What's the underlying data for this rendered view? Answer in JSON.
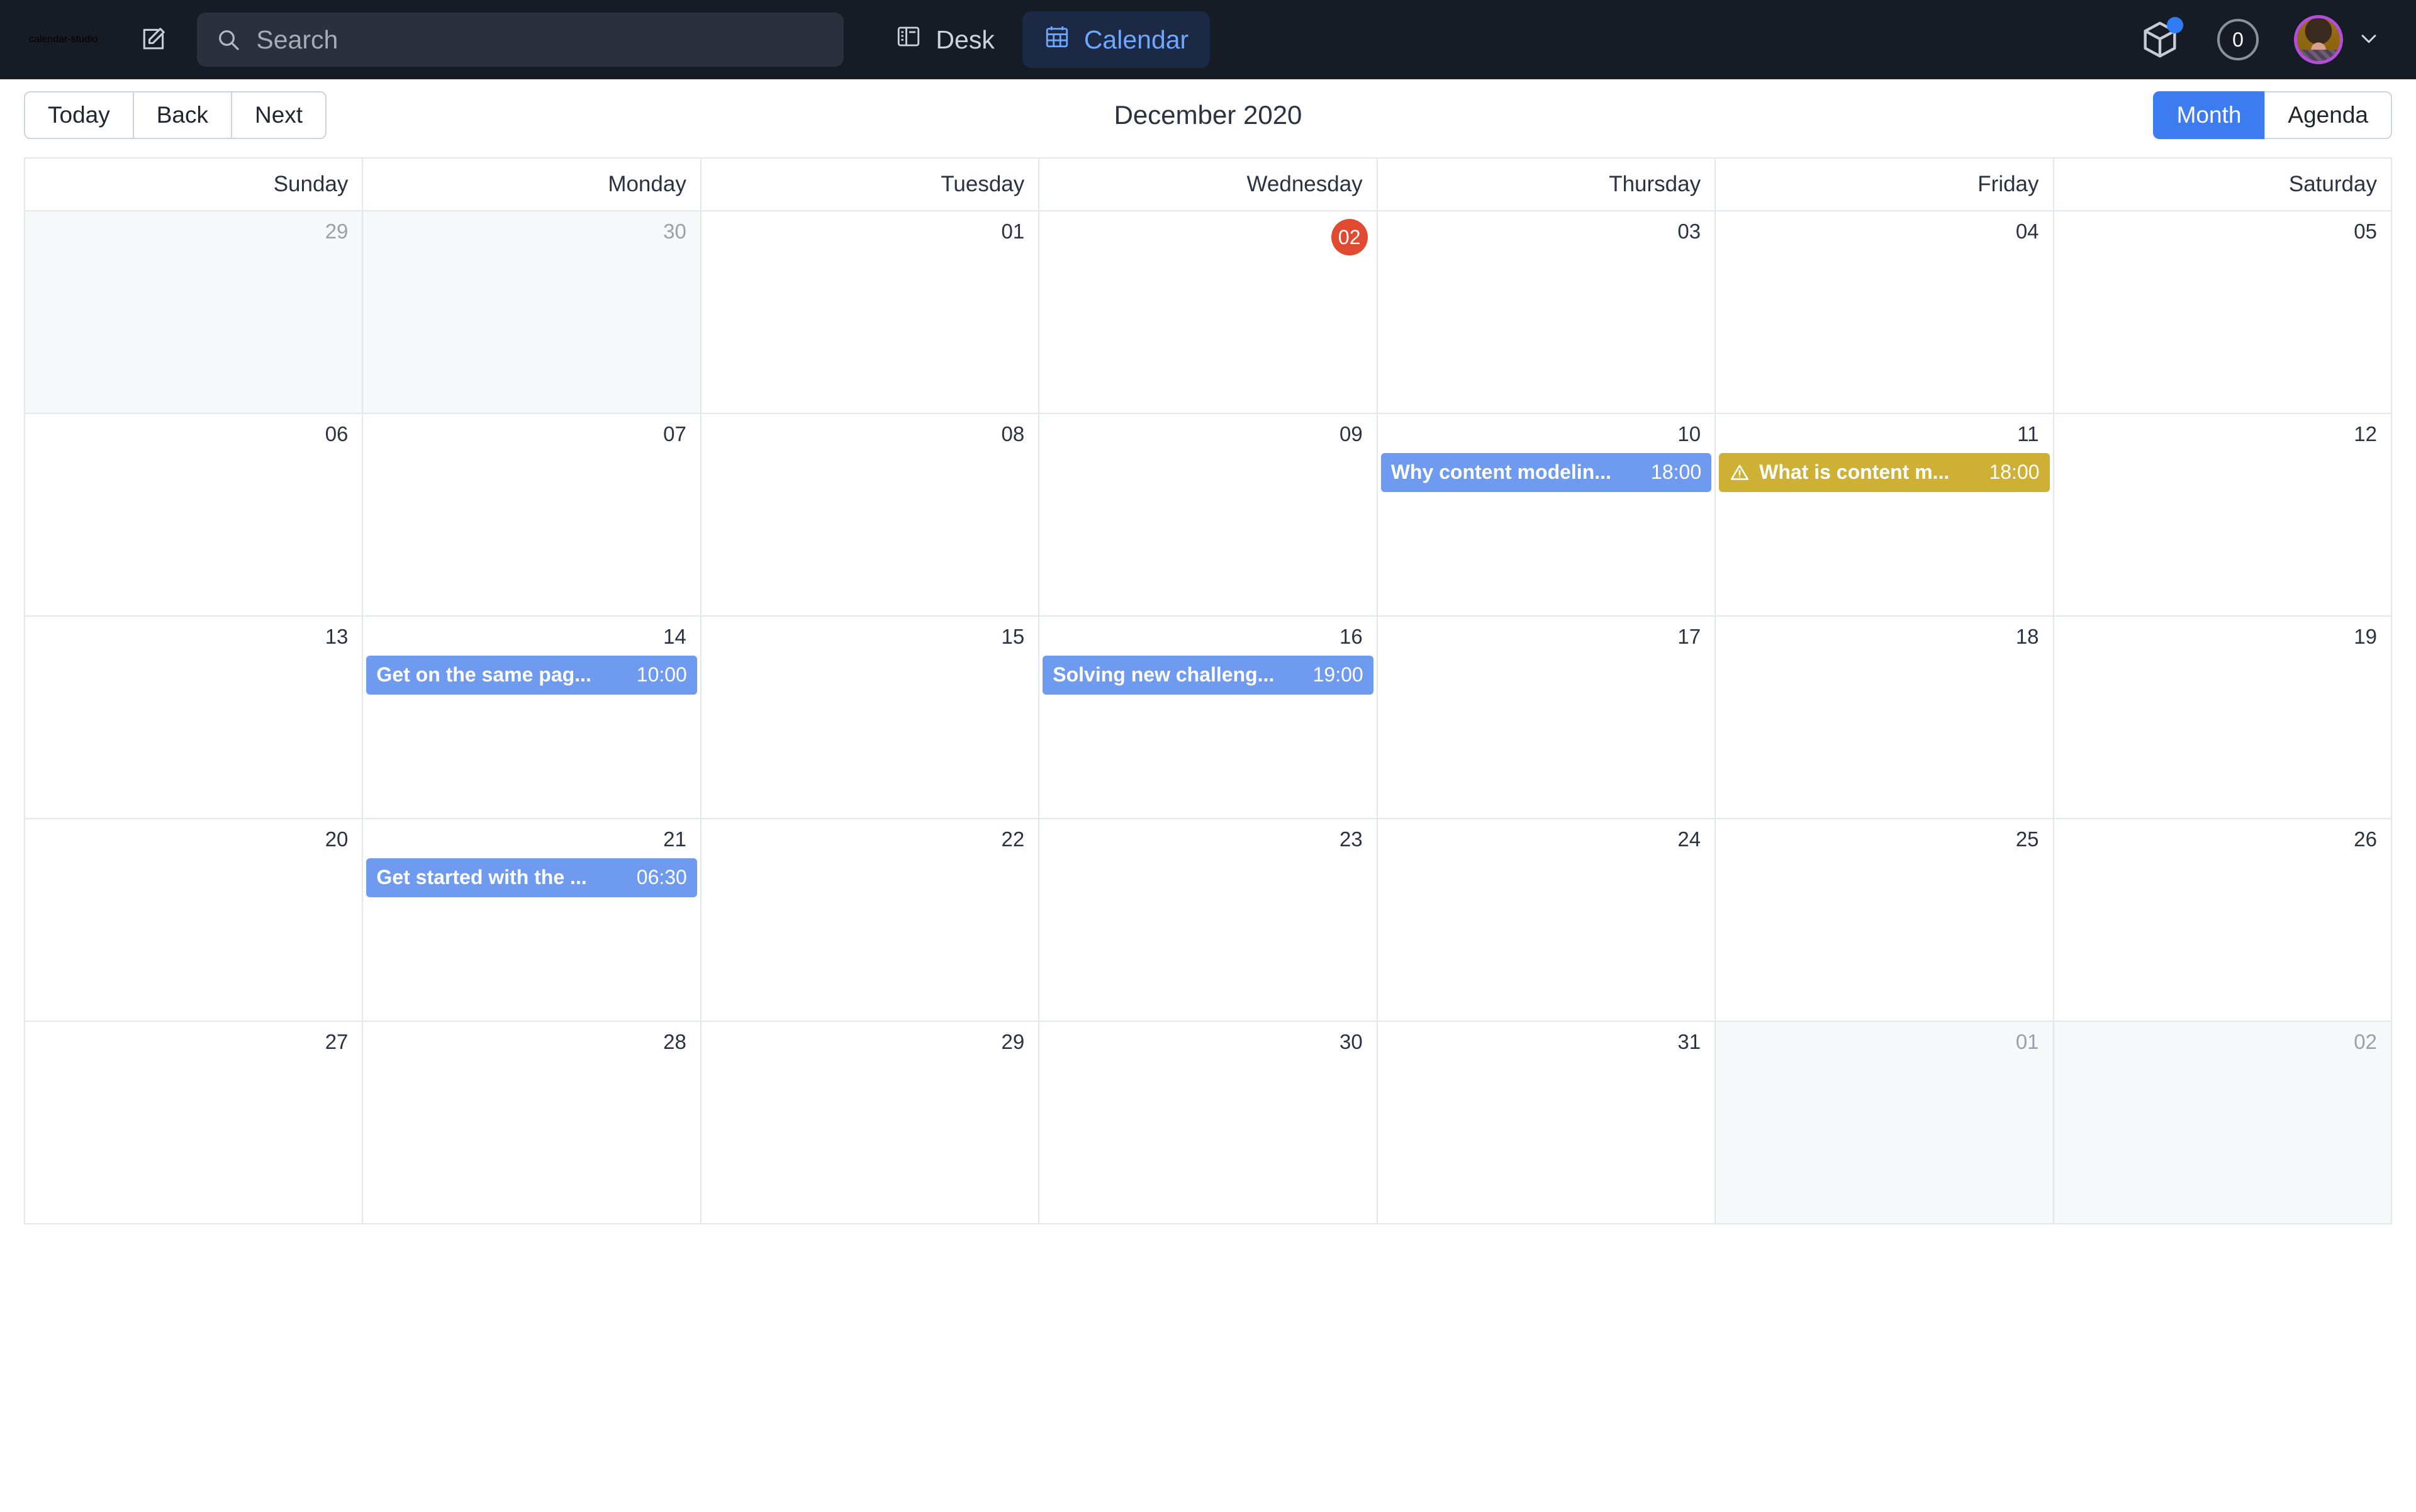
{
  "navbar": {
    "brand": "calendar-studio",
    "compose_icon": "compose-edit-icon",
    "search": {
      "value": "",
      "placeholder": "Search",
      "icon": "search-icon"
    },
    "tabs": [
      {
        "label": "Desk",
        "icon": "desk-layout-icon",
        "active": false
      },
      {
        "label": "Calendar",
        "icon": "calendar-grid-icon",
        "active": true
      }
    ],
    "package_icon": "package-box-icon",
    "package_has_badge": true,
    "notification_count": "0",
    "avatar_icon": "user-avatar",
    "avatar_ring_color": "#b44ddb",
    "chevron_icon": "chevron-down-icon"
  },
  "toolbar": {
    "nav_buttons": [
      {
        "label": "Today"
      },
      {
        "label": "Back"
      },
      {
        "label": "Next"
      }
    ],
    "title": "December 2020",
    "views": [
      {
        "label": "Month",
        "active": true
      },
      {
        "label": "Agenda",
        "active": false
      }
    ],
    "active_color": "#3c7cf0"
  },
  "calendar": {
    "day_headers": [
      "Sunday",
      "Monday",
      "Tuesday",
      "Wednesday",
      "Thursday",
      "Friday",
      "Saturday"
    ],
    "today_color": "#df4a31",
    "event_colors": {
      "blue": "#6e9bf0",
      "yellow": "#cdb034"
    },
    "weeks": [
      [
        {
          "num": "29",
          "off": true,
          "today": false,
          "events": []
        },
        {
          "num": "30",
          "off": true,
          "today": false,
          "events": []
        },
        {
          "num": "01",
          "off": false,
          "today": false,
          "events": []
        },
        {
          "num": "02",
          "off": false,
          "today": true,
          "events": []
        },
        {
          "num": "03",
          "off": false,
          "today": false,
          "events": []
        },
        {
          "num": "04",
          "off": false,
          "today": false,
          "events": []
        },
        {
          "num": "05",
          "off": false,
          "today": false,
          "events": []
        }
      ],
      [
        {
          "num": "06",
          "off": false,
          "today": false,
          "events": []
        },
        {
          "num": "07",
          "off": false,
          "today": false,
          "events": []
        },
        {
          "num": "08",
          "off": false,
          "today": false,
          "events": []
        },
        {
          "num": "09",
          "off": false,
          "today": false,
          "events": []
        },
        {
          "num": "10",
          "off": false,
          "today": false,
          "events": [
            {
              "title": "Why content modelin...",
              "time": "18:00",
              "color": "blue",
              "warning": false
            }
          ]
        },
        {
          "num": "11",
          "off": false,
          "today": false,
          "events": [
            {
              "title": "What is content m...",
              "time": "18:00",
              "color": "yellow",
              "warning": true
            }
          ]
        },
        {
          "num": "12",
          "off": false,
          "today": false,
          "events": []
        }
      ],
      [
        {
          "num": "13",
          "off": false,
          "today": false,
          "events": []
        },
        {
          "num": "14",
          "off": false,
          "today": false,
          "events": [
            {
              "title": "Get on the same pag...",
              "time": "10:00",
              "color": "blue",
              "warning": false
            }
          ]
        },
        {
          "num": "15",
          "off": false,
          "today": false,
          "events": []
        },
        {
          "num": "16",
          "off": false,
          "today": false,
          "events": [
            {
              "title": "Solving new challeng...",
              "time": "19:00",
              "color": "blue",
              "warning": false
            }
          ]
        },
        {
          "num": "17",
          "off": false,
          "today": false,
          "events": []
        },
        {
          "num": "18",
          "off": false,
          "today": false,
          "events": []
        },
        {
          "num": "19",
          "off": false,
          "today": false,
          "events": []
        }
      ],
      [
        {
          "num": "20",
          "off": false,
          "today": false,
          "events": []
        },
        {
          "num": "21",
          "off": false,
          "today": false,
          "events": [
            {
              "title": "Get started with the ...",
              "time": "06:30",
              "color": "blue",
              "warning": false
            }
          ]
        },
        {
          "num": "22",
          "off": false,
          "today": false,
          "events": []
        },
        {
          "num": "23",
          "off": false,
          "today": false,
          "events": []
        },
        {
          "num": "24",
          "off": false,
          "today": false,
          "events": []
        },
        {
          "num": "25",
          "off": false,
          "today": false,
          "events": []
        },
        {
          "num": "26",
          "off": false,
          "today": false,
          "events": []
        }
      ],
      [
        {
          "num": "27",
          "off": false,
          "today": false,
          "events": []
        },
        {
          "num": "28",
          "off": false,
          "today": false,
          "events": []
        },
        {
          "num": "29",
          "off": false,
          "today": false,
          "events": []
        },
        {
          "num": "30",
          "off": false,
          "today": false,
          "events": []
        },
        {
          "num": "31",
          "off": false,
          "today": false,
          "events": []
        },
        {
          "num": "01",
          "off": true,
          "today": false,
          "events": []
        },
        {
          "num": "02",
          "off": true,
          "today": false,
          "events": []
        }
      ]
    ]
  }
}
